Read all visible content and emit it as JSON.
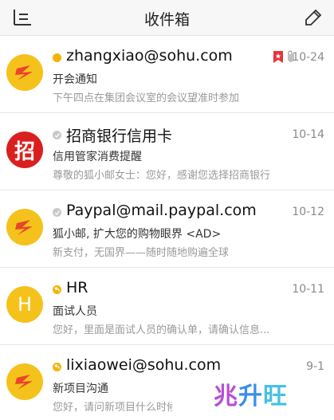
{
  "header": {
    "title": "收件箱",
    "left_icon": "menu-icon",
    "right_icon": "compose-icon"
  },
  "colors": {
    "accent": "#f3b500",
    "bank_red": "#d9201f",
    "flag_red": "#e8333a"
  },
  "mails": [
    {
      "status": "unread",
      "avatar": "sohu-logo",
      "sender": "zhangxiao@sohu.com",
      "date": "10-24",
      "subject": "开会通知",
      "preview": "下午四点在集团会议室的会议望准时参加",
      "flagged": true,
      "attachment": true
    },
    {
      "status": "read",
      "avatar": "招",
      "sender": "招商银行信用卡",
      "date": "10-14",
      "subject": "信用管家消费提醒",
      "preview": "尊敬的狐小邮女士：您好，感谢您选择招商银行"
    },
    {
      "status": "read",
      "avatar": "sohu-logo",
      "sender": "Paypal@mail.paypal.com",
      "date": "10-12",
      "subject": "狐小邮, 扩大您的购物眼界 <AD>",
      "preview": "新支付，无国界——随时随地购遍全球"
    },
    {
      "status": "replied",
      "avatar": "H",
      "sender": "HR",
      "date": "10-11",
      "subject": "面试人员",
      "preview": "您好，里面是面试人员的确认单，请确认信息..."
    },
    {
      "status": "replied",
      "avatar": "sohu-logo",
      "sender": "lixiaowei@sohu.com",
      "date": "9-1",
      "subject": "新项目沟通",
      "preview": "您好，请问新项目什么时候"
    }
  ],
  "watermark": {
    "part1": "兆",
    "part2": "升",
    "part3": "旺"
  }
}
